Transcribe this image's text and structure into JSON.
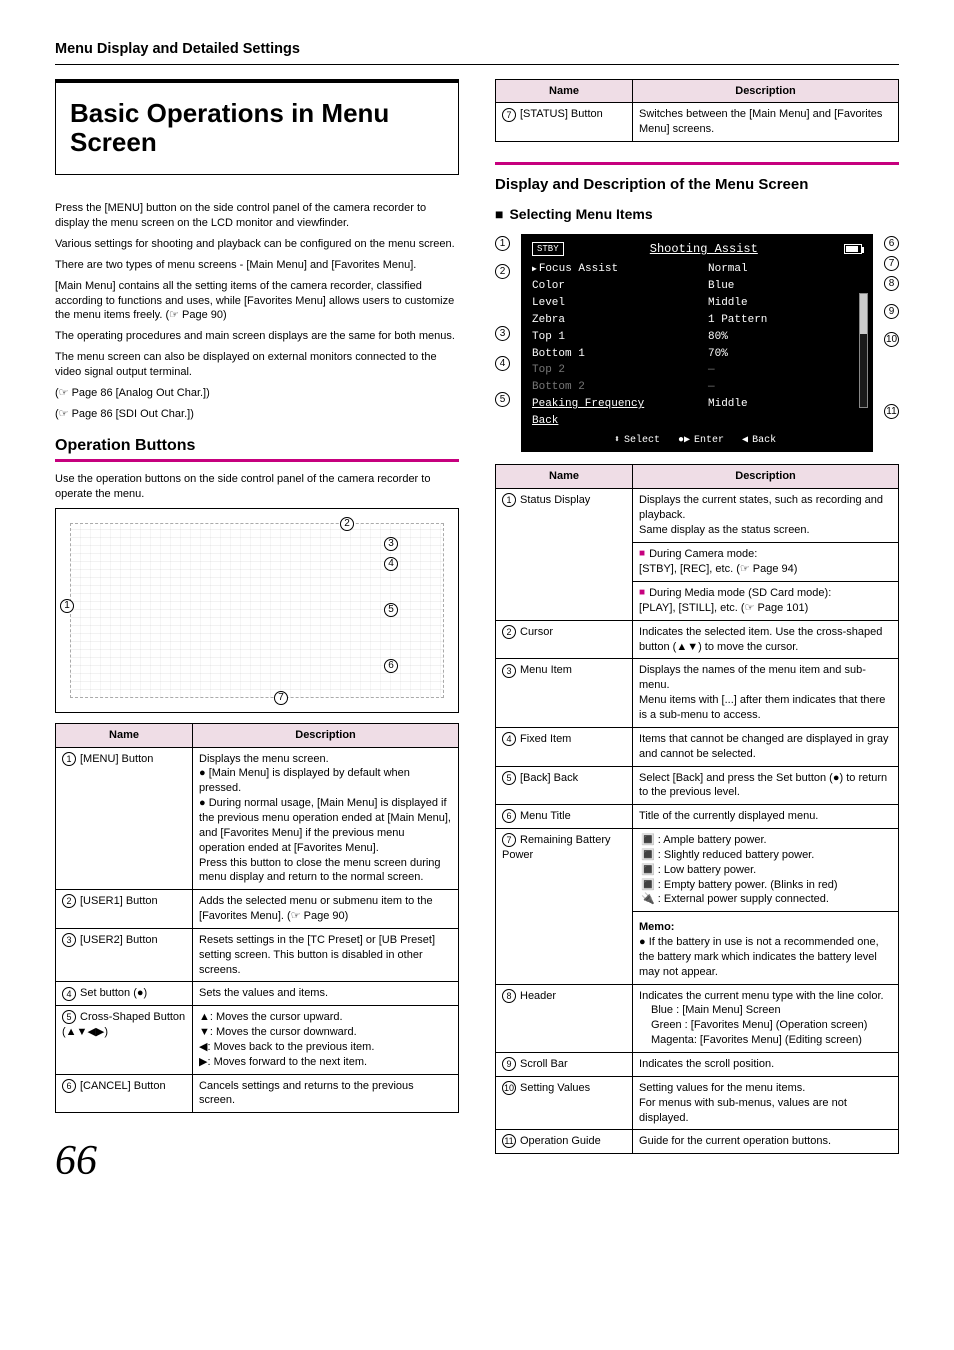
{
  "header": "Menu Display and Detailed Settings",
  "page_number": "66",
  "main_title": "Basic Operations in Menu Screen",
  "intro_paragraphs": [
    "Press the [MENU] button on the side control panel of the camera recorder to display the menu screen on the LCD monitor and viewfinder.",
    "Various settings for shooting and playback can be configured on the menu screen.",
    "There are two types of menu screens - [Main Menu] and [Favorites Menu].",
    "[Main Menu] contains all the setting items of the camera recorder, classified according to functions and uses, while [Favorites Menu] allows users to customize the menu items freely. (☞ Page 90)",
    "The operating procedures and main screen displays are the same for both menus.",
    "The menu screen can also be displayed on external monitors connected to the video signal output terminal."
  ],
  "intro_refs": [
    "(☞ Page 86 [Analog Out Char.])",
    "(☞ Page 86 [SDI Out Char.])"
  ],
  "operation_buttons": {
    "heading": "Operation Buttons",
    "subtext": "Use the operation buttons on the side control panel of the camera recorder to operate the menu.",
    "cols": {
      "name": "Name",
      "desc": "Description"
    },
    "rows": [
      {
        "num": "1",
        "name": "[MENU] Button",
        "desc": "Displays the menu screen.\n● [Main Menu] is displayed by default when pressed.\n● During normal usage, [Main Menu] is displayed if the previous menu operation ended at [Main Menu], and [Favorites Menu] if the previous menu operation ended at [Favorites Menu].\nPress this button to close the menu screen during menu display and return to the normal screen."
      },
      {
        "num": "2",
        "name": "[USER1] Button",
        "desc": "Adds the selected menu or submenu item to the [Favorites Menu]. (☞ Page 90)"
      },
      {
        "num": "3",
        "name": "[USER2] Button",
        "desc": "Resets settings in the [TC Preset] or [UB Preset] setting screen. This button is disabled in other screens."
      },
      {
        "num": "4",
        "name": "Set button (●)",
        "desc": "Sets the values and items."
      },
      {
        "num": "5",
        "name": "Cross-Shaped Button (▲▼◀▶)",
        "desc": "▲: Moves the cursor upward.\n▼: Moves the cursor downward.\n◀: Moves back to the previous item.\n▶: Moves forward to the next item."
      },
      {
        "num": "6",
        "name": "[CANCEL] Button",
        "desc": "Cancels settings and returns to the previous screen."
      }
    ]
  },
  "top_right_table": {
    "cols": {
      "name": "Name",
      "desc": "Description"
    },
    "rows": [
      {
        "num": "7",
        "name": "[STATUS] Button",
        "desc": "Switches between the [Main Menu] and [Favorites Menu] screens."
      }
    ]
  },
  "menu_screen": {
    "heading1": "Display and Description of the Menu Screen",
    "heading2": "Selecting Menu Items",
    "status_label": "STBY",
    "title": "Shooting Assist",
    "left_items": [
      "Focus Assist",
      "Color",
      "Level",
      "Zebra",
      "Top 1",
      "Bottom 1",
      "Top 2",
      "Bottom 2",
      "Peaking Frequency",
      "Back"
    ],
    "right_items": [
      "Normal",
      "Blue",
      "Middle",
      "1 Pattern",
      "80%",
      "70%",
      "—",
      "—",
      "Middle",
      ""
    ],
    "footer": {
      "select": "Select",
      "enter": "Enter",
      "back": "Back"
    },
    "callouts": [
      "1",
      "2",
      "3",
      "4",
      "5",
      "6",
      "7",
      "8",
      "9",
      "10",
      "11"
    ]
  },
  "screen_desc": {
    "cols": {
      "name": "Name",
      "desc": "Description"
    },
    "rows": [
      {
        "num": "1",
        "name": "Status Display",
        "desc": "Displays the current states, such as recording and playback.\nSame display as the status screen.",
        "subA_label": "During Camera mode:",
        "subA_body": "[STBY], [REC], etc. (☞ Page 94)",
        "subB_label": "During Media mode (SD Card mode):",
        "subB_body": "[PLAY], [STILL], etc. (☞ Page 101)"
      },
      {
        "num": "2",
        "name": "Cursor",
        "desc": "Indicates the selected item. Use the cross-shaped button (▲▼) to move the cursor."
      },
      {
        "num": "3",
        "name": "Menu Item",
        "desc": "Displays the names of the menu item and sub-menu.\nMenu items with [...] after them indicates that there is a sub-menu to access."
      },
      {
        "num": "4",
        "name": "Fixed Item",
        "desc": "Items that cannot be changed are displayed in gray and cannot be selected."
      },
      {
        "num": "5",
        "name": "[Back] Back",
        "desc": "Select [Back] and press the Set button (●) to return to the previous level."
      },
      {
        "num": "6",
        "name": "Menu Title",
        "desc": "Title of the currently displayed menu."
      },
      {
        "num": "7",
        "name": "Remaining Battery Power",
        "desc_lines": [
          "🔳 : Ample battery power.",
          "🔳 : Slightly reduced battery power.",
          "🔳 : Low battery power.",
          "🔳 : Empty battery power. (Blinks in red)",
          "🔌 : External power supply connected."
        ],
        "memo_label": "Memo:",
        "memo_body": "● If the battery in use is not a recommended one, the battery mark which indicates the battery level may not appear."
      },
      {
        "num": "8",
        "name": "Header",
        "desc": "Indicates the current menu type with the line color.",
        "lines": [
          "Blue      : [Main Menu] Screen",
          "Green    : [Favorites Menu] (Operation screen)",
          "Magenta: [Favorites Menu] (Editing screen)"
        ]
      },
      {
        "num": "9",
        "name": "Scroll Bar",
        "desc": "Indicates the scroll position."
      },
      {
        "num": "10",
        "name": "Setting Values",
        "desc": "Setting values for the menu items.\nFor menus with sub-menus, values are not displayed."
      },
      {
        "num": "11",
        "name": "Operation Guide",
        "desc": "Guide for the current operation buttons."
      }
    ]
  }
}
